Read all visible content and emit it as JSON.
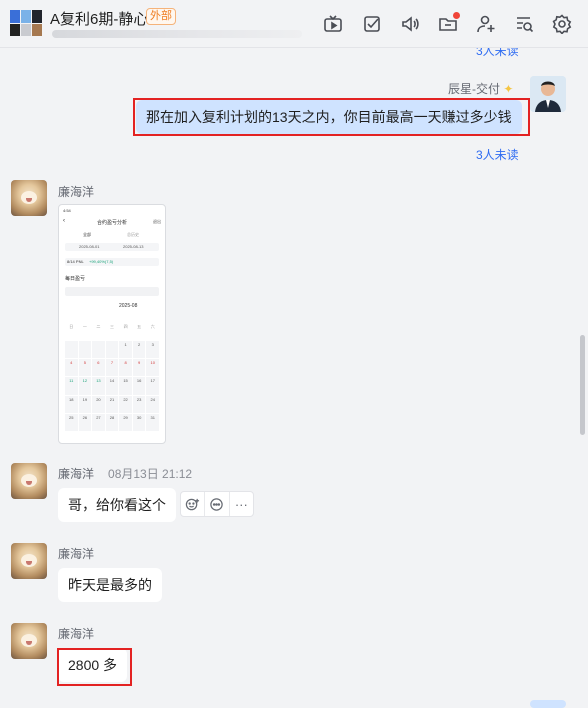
{
  "header": {
    "title": "A复利6期-静心",
    "external_badge": "外部",
    "toolbar": {
      "icons": [
        "tv-icon",
        "check-square-icon",
        "speaker-icon",
        "folder-icon",
        "add-user-icon",
        "chat-search-icon",
        "settings-icon"
      ]
    }
  },
  "messages": [
    {
      "type": "readcount",
      "text": "3人未读"
    },
    {
      "type": "text",
      "sender": "辰星-交付",
      "mine": true,
      "text": "那在加入复利计划的13天之内，你目前最高一天赚过多少钱",
      "read": "3人未读"
    },
    {
      "type": "image",
      "sender": "廉海洋"
    },
    {
      "type": "text",
      "sender": "廉海洋",
      "time": "08月13日 21:12",
      "text": "哥，给你看这个"
    },
    {
      "type": "text",
      "sender": "廉海洋",
      "text": "昨天是最多的"
    },
    {
      "type": "text",
      "sender": "廉海洋",
      "text": "2800 多"
    }
  ],
  "screenshot": {
    "status": "4:54",
    "title": "合约盈亏分析",
    "nav_right": "退出",
    "tabs": [
      "全部",
      "总历史"
    ],
    "date_from": "2025-08-01",
    "date_to": "2025-08-13",
    "pnl_label": "8/14 PNL",
    "pnl_value": "+99,40%(7,5)",
    "section": "每日盈亏",
    "month": "2025-08",
    "weekdays": [
      "日",
      "一",
      "二",
      "三",
      "四",
      "五",
      "六"
    ],
    "calendar": [
      "",
      "",
      "",
      "",
      "1",
      "2",
      "3",
      "4",
      "5",
      "6",
      "7",
      "8",
      "9",
      "10",
      "11",
      "12",
      "13",
      "14",
      "15",
      "16",
      "17",
      "18",
      "19",
      "20",
      "21",
      "22",
      "23",
      "24",
      "25",
      "26",
      "27",
      "28",
      "29",
      "30",
      "31",
      ""
    ]
  },
  "reactions": [
    "emoji-add-icon",
    "comment-icon",
    "more-icon"
  ],
  "colors": {
    "accent": "#2f6cf2",
    "mine_bubble": "#cfe3ff",
    "highlight": "#e32222",
    "badge": "#ef7d22"
  }
}
